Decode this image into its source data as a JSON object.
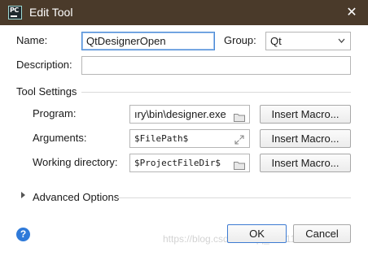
{
  "window": {
    "title": "Edit Tool",
    "app_icon_label": "PC",
    "close_glyph": "✕"
  },
  "form": {
    "name_label": "Name:",
    "name_value": "QtDesignerOpen",
    "group_label": "Group:",
    "group_value": "Qt",
    "description_label": "Description:",
    "description_value": ""
  },
  "tool_settings": {
    "section_label": "Tool Settings",
    "program_label": "Program:",
    "program_value": "ıry\\bin\\designer.exe",
    "arguments_label": "Arguments:",
    "arguments_value": "$FilePath$",
    "working_dir_label": "Working directory:",
    "working_dir_value": "$ProjectFileDir$",
    "insert_macro_label": "Insert Macro..."
  },
  "advanced": {
    "label": "Advanced Options"
  },
  "footer": {
    "help_glyph": "?",
    "ok_label": "OK",
    "cancel_label": "Cancel",
    "watermark": "https://blog.csdn.net/qq_40911233"
  },
  "colors": {
    "titlebar": "#4a3a2a",
    "focus_border": "#4a8ad6",
    "help_icon": "#2f7ad9"
  },
  "icons": {
    "folder": "folder-icon",
    "expand": "expand-icon",
    "combo": "chevron-down-icon",
    "help": "help-icon",
    "close": "close-icon"
  }
}
